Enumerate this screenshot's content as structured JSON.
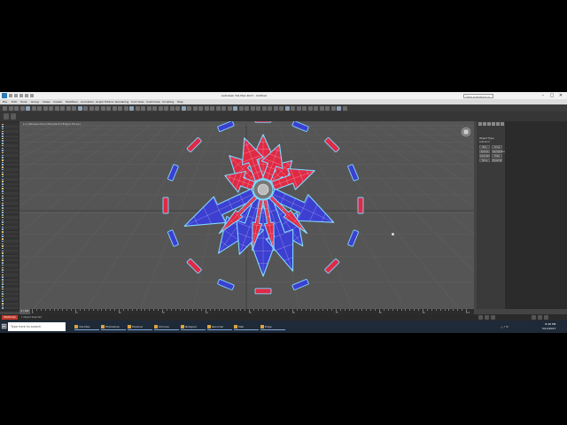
{
  "window": {
    "title": "Autodesk 3ds Max 2017 - Untitled",
    "search_placeholder": "Type a keyword or phrase",
    "controls": [
      "–",
      "□",
      "✕"
    ]
  },
  "menu": {
    "items": [
      "File",
      "Edit",
      "Tools",
      "Group",
      "Views",
      "Create",
      "Modifiers",
      "Animation",
      "Graph Editors",
      "Rendering",
      "Civil View",
      "Customize",
      "Scripting",
      "Help"
    ]
  },
  "viewport": {
    "label": "[+] [Perspective] [Standard] [Edged Faces]",
    "colors": {
      "red": "#e02a45",
      "blue": "#3c3fd0",
      "edge": "#7fd6ff",
      "grid": "#5f5f5f"
    }
  },
  "command_panel": {
    "title": "Object Type",
    "buttons": [
      "Box",
      "Cone",
      "Sphere",
      "GeoSphere",
      "Cylinder",
      "Tube",
      "Torus",
      "Pyramid"
    ],
    "extra": "AutoGrid"
  },
  "status": {
    "prompt": "MAXScript",
    "text": "1 Object Selected",
    "frames": "0 / 100",
    "tick_labels": [
      "0",
      "10",
      "20",
      "30",
      "40",
      "50",
      "60",
      "70",
      "80",
      "90",
      "100"
    ]
  },
  "taskbar": {
    "start_icon": "windows-icon",
    "search": "Type here to search",
    "apps": [
      {
        "label": "3ds Max",
        "icon": "app-icon"
      },
      {
        "label": "Photoshop",
        "icon": "app-icon"
      },
      {
        "label": "Explorer",
        "icon": "folder-icon"
      },
      {
        "label": "Chrome",
        "icon": "browser-icon"
      },
      {
        "label": "Notepad",
        "icon": "app-icon"
      },
      {
        "label": "Recorder",
        "icon": "app-icon"
      },
      {
        "label": "Mail",
        "icon": "app-icon"
      },
      {
        "label": "Edge",
        "icon": "browser-icon"
      }
    ],
    "time": "8:46 PM",
    "date": "5/12/2017"
  }
}
